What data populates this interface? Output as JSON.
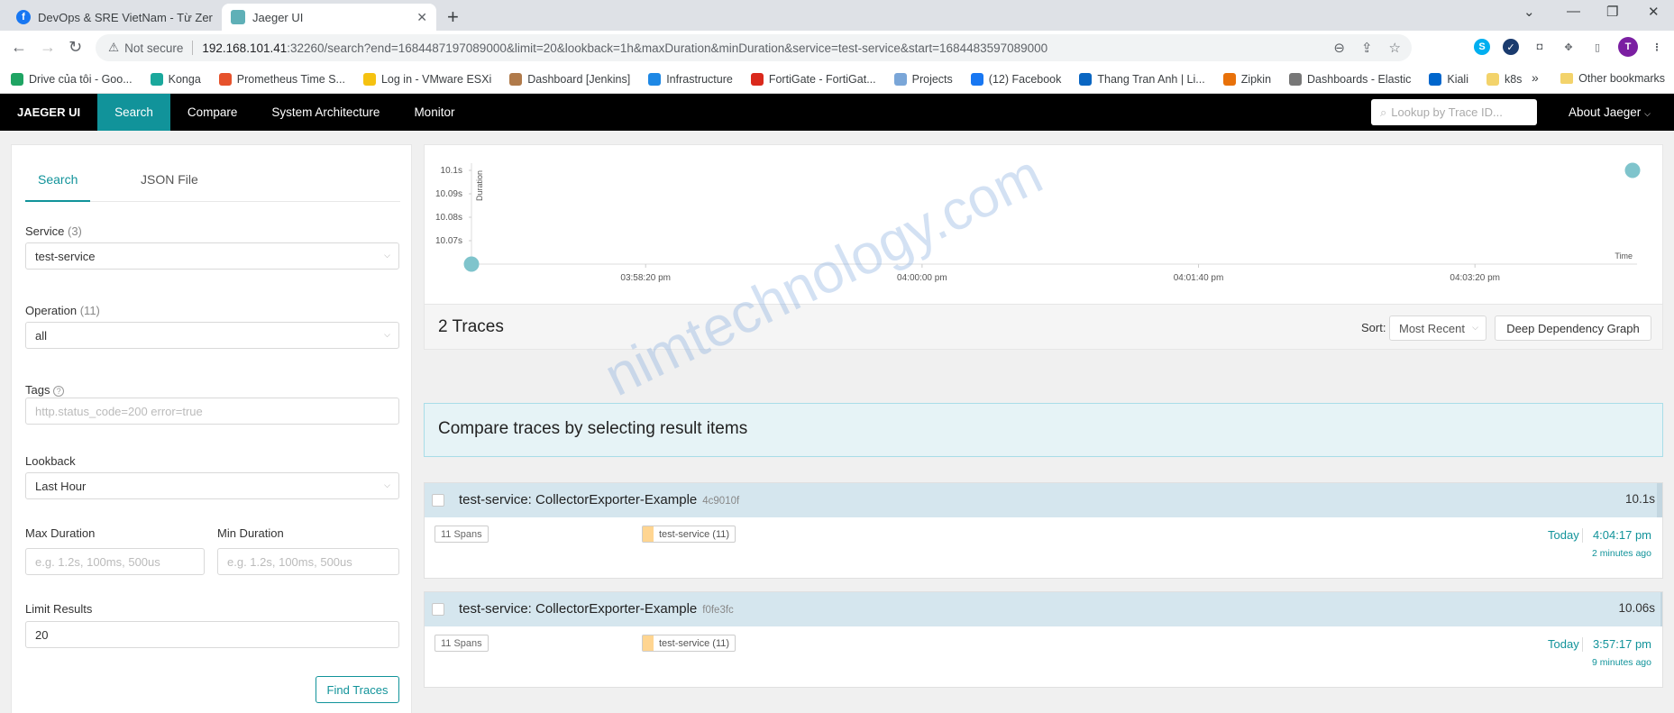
{
  "browser": {
    "tabs": [
      {
        "title": "DevOps & SRE VietNam - Từ Zer",
        "active": false
      },
      {
        "title": "Jaeger UI",
        "active": true
      }
    ],
    "new_tab": "+",
    "address": {
      "security": "Not secure",
      "host": "192.168.101.41",
      "rest": ":32260/search?end=1684487197089000&limit=20&lookback=1h&maxDuration&minDuration&service=test-service&start=1684483597089000"
    },
    "profile_initial": "T",
    "bookmarks": [
      {
        "label": "Drive của tôi - Goo...",
        "color": "#1fa463"
      },
      {
        "label": "Konga",
        "color": "#1aa89c"
      },
      {
        "label": "Prometheus Time S...",
        "color": "#e6522c"
      },
      {
        "label": "Log in - VMware ESXi",
        "color": "#f5c211"
      },
      {
        "label": "Dashboard [Jenkins]",
        "color": "#b07a4a"
      },
      {
        "label": "Infrastructure",
        "color": "#1e88e5"
      },
      {
        "label": "FortiGate - FortiGat...",
        "color": "#da291c"
      },
      {
        "label": "Projects",
        "color": "#7aa6d8"
      },
      {
        "label": "(12) Facebook",
        "color": "#1877f2"
      },
      {
        "label": "Thang Tran Anh | Li...",
        "color": "#0a66c2"
      },
      {
        "label": "Zipkin",
        "color": "#e8710a"
      },
      {
        "label": "Dashboards - Elastic",
        "color": "#777777"
      },
      {
        "label": "Kiali",
        "color": "#0066cc"
      },
      {
        "label": "k8s",
        "color": "#f3d36b"
      }
    ],
    "bookmarks_more": "»",
    "other_bookmarks": "Other bookmarks"
  },
  "jaeger_nav": {
    "brand": "JAEGER UI",
    "items": [
      "Search",
      "Compare",
      "System Architecture",
      "Monitor"
    ],
    "active": "Search",
    "lookup_placeholder": "Lookup by Trace ID...",
    "about": "About Jaeger"
  },
  "search_panel": {
    "tabs": [
      "Search",
      "JSON File"
    ],
    "service": {
      "label": "Service",
      "count": "(3)",
      "value": "test-service"
    },
    "operation": {
      "label": "Operation",
      "count": "(11)",
      "value": "all"
    },
    "tags": {
      "label": "Tags",
      "help": "?",
      "placeholder": "http.status_code=200 error=true"
    },
    "lookback": {
      "label": "Lookback",
      "value": "Last Hour"
    },
    "max_duration": {
      "label": "Max Duration",
      "placeholder": "e.g. 1.2s, 100ms, 500us"
    },
    "min_duration": {
      "label": "Min Duration",
      "placeholder": "e.g. 1.2s, 100ms, 500us"
    },
    "limit": {
      "label": "Limit Results",
      "value": "20"
    },
    "find_button": "Find Traces"
  },
  "chart_data": {
    "type": "scatter",
    "ylabel": "Duration",
    "xlabel": "Time",
    "y_ticks": [
      "10.1s",
      "10.09s",
      "10.08s",
      "10.07s"
    ],
    "x_ticks": [
      "03:58:20 pm",
      "04:00:00 pm",
      "04:01:40 pm",
      "04:03:20 pm"
    ],
    "y_range": [
      10.06,
      10.1
    ],
    "x_range_seconds": [
      14237,
      14657
    ],
    "points": [
      {
        "x_seconds": 14237,
        "y": 10.06,
        "label": "3:57:17 pm"
      },
      {
        "x_seconds": 14657,
        "y": 10.1,
        "label": "4:04:17 pm"
      }
    ],
    "point_color": "#7fc4cc"
  },
  "results": {
    "count_label": "2 Traces",
    "sort_label": "Sort:",
    "sort_value": "Most Recent",
    "ddg_button": "Deep Dependency Graph",
    "compare_text": "Compare traces by selecting result items",
    "traces": [
      {
        "name": "test-service: CollectorExporter-Example",
        "id": "4c9010f",
        "duration": "10.1s",
        "spans": "11 Spans",
        "service": "test-service (11)",
        "day": "Today",
        "time": "4:04:17 pm",
        "ago": "2 minutes ago"
      },
      {
        "name": "test-service: CollectorExporter-Example",
        "id": "f0fe3fc",
        "duration": "10.06s",
        "spans": "11 Spans",
        "service": "test-service (11)",
        "day": "Today",
        "time": "3:57:17 pm",
        "ago": "9 minutes ago"
      }
    ]
  },
  "watermark": "nimtechnology.com"
}
